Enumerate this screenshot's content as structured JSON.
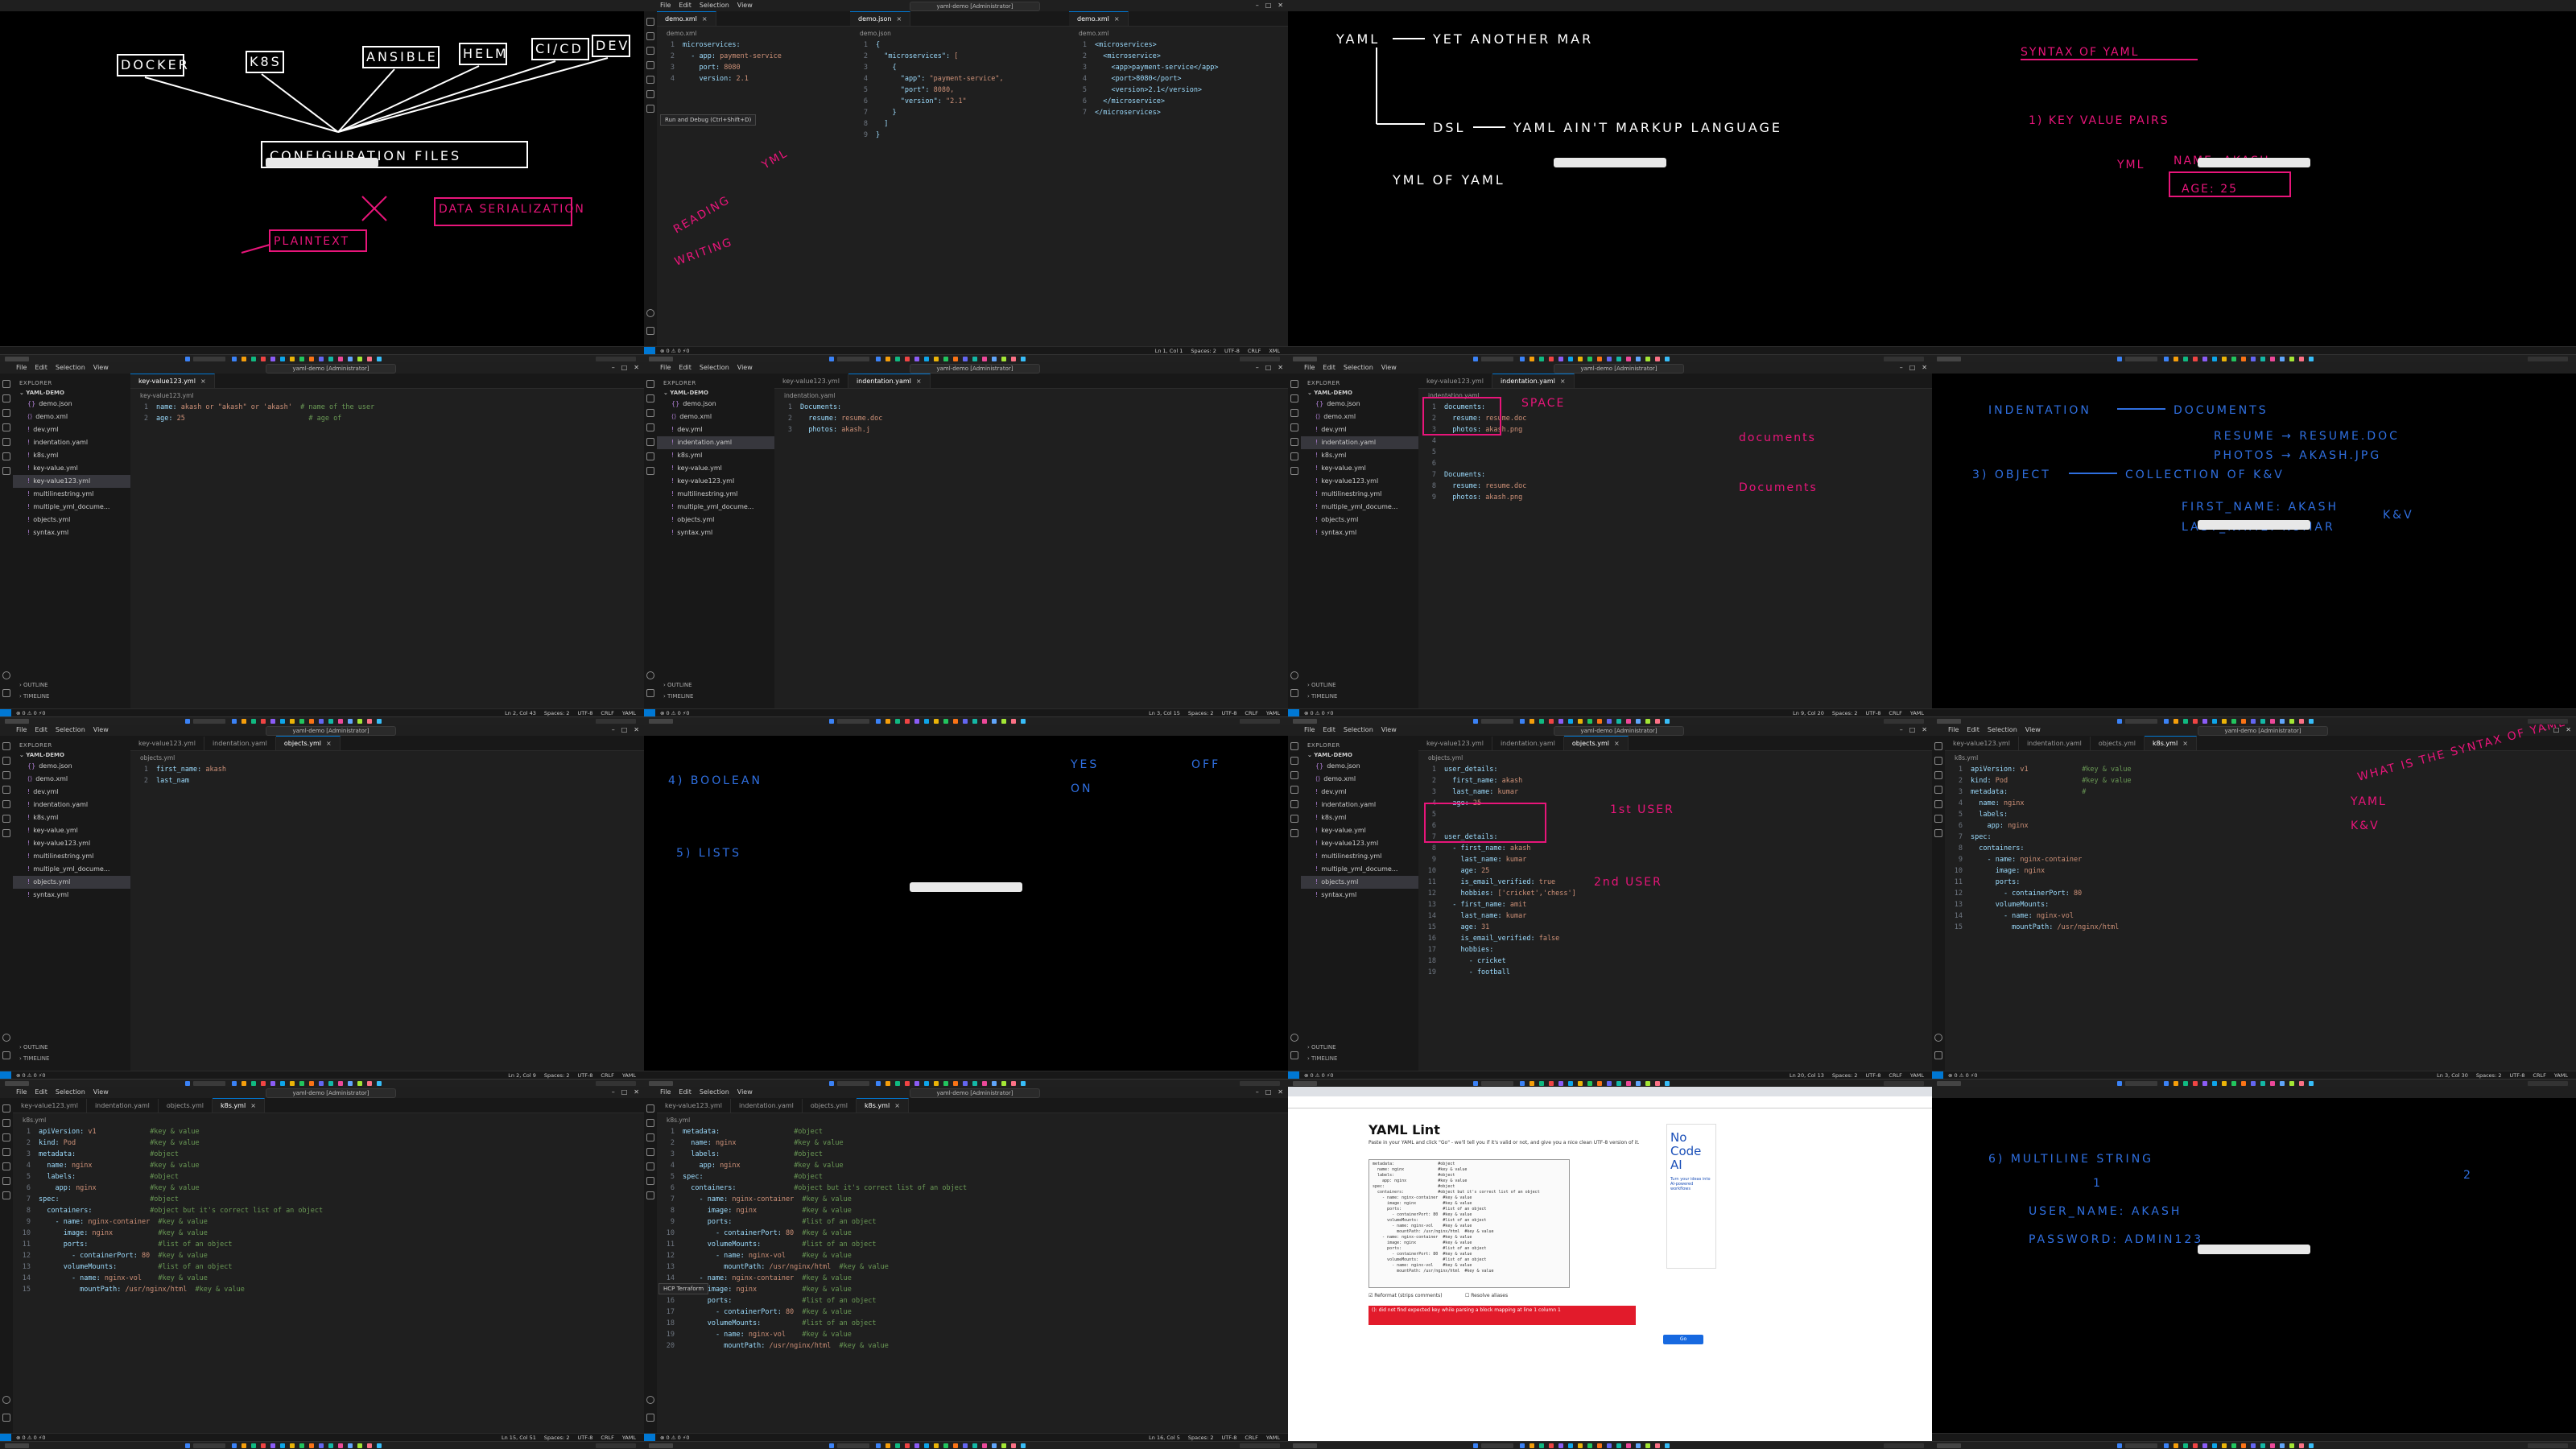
{
  "window": {
    "title": "yaml-demo [Administrator]",
    "menu": [
      "File",
      "Edit",
      "Selection",
      "View"
    ]
  },
  "explorer": {
    "header": "EXPLORER",
    "folder": "YAML-DEMO",
    "outline": "OUTLINE",
    "timeline": "TIMELINE"
  },
  "status": {
    "spaces": "Spaces: 2",
    "encoding": "UTF-8",
    "eol": "CRLF",
    "lang": "YAML"
  },
  "tiles": {
    "t1": {
      "words": [
        "DOCKER",
        "K8S",
        "ANSIBLE",
        "HELM",
        "CI/CD",
        "DEV"
      ],
      "center": "CONFIGURATION FILES",
      "p1": "PLAINTEXT",
      "p2": "DATA SERIALIZATION"
    },
    "t2": {
      "tabs": [
        "demo.xml",
        "demo.json",
        "demo.xml"
      ],
      "leftCode": [
        "microservices:",
        "  - app: payment-service",
        "    port: 8080",
        "    version: 2.1"
      ],
      "midCode": [
        "{",
        "  \"microservices\": [",
        "    {",
        "      \"app\": \"payment-service\",",
        "      \"port\": 8080,",
        "      \"version\": \"2.1\"",
        "    }",
        "  ]",
        "}"
      ],
      "rightCode": [
        "<microservices>",
        "  <microservice>",
        "    <app>payment-service</app>",
        "    <port>8080</port>",
        "    <version>2.1</version>",
        "  </microservice>",
        "</microservices>"
      ],
      "hover": "Run and Debug (Ctrl+Shift+D)",
      "ink1": "READING",
      "ink2": "WRITING",
      "ink3": "YML",
      "cursor": "Ln 1, Col 1",
      "lang": "XML"
    },
    "t3": {
      "l1a": "YAML",
      "l1b": "YET ANOTHER MAR",
      "l2a": "DSL",
      "l2b": "YAML AIN'T MARKUP LANGUAGE",
      "l3": "YML OF YAML"
    },
    "t4": {
      "title": "SYNTAX OF YAML",
      "item": "1) KEY VALUE PAIRS",
      "ex1": "NAME: AKASH",
      "ex2": "AGE: 25",
      "lbl": "YML"
    },
    "t5": {
      "tab": "key-value123.yml",
      "code": [
        "name: akash or \"akash\" or 'akash'  # name of the user",
        "age: 25                              # age of"
      ],
      "cursor": "Ln 2, Col 43"
    },
    "t6": {
      "tabs": [
        "key-value123.yml",
        "indentation.yaml"
      ],
      "code": [
        "Documents:",
        "  resume: resume.doc",
        "  photos: akash.j"
      ],
      "cursor": "Ln 3, Col 15"
    },
    "t7": {
      "tabs": [
        "key-value123.yml",
        "indentation.yaml"
      ],
      "code": [
        "documents:",
        "  resume: resume.doc",
        "  photos: akash.png",
        "",
        "",
        "",
        "Documents:",
        "  resume: resume.doc",
        "  photos: akash.png"
      ],
      "ink1": "SPACE",
      "ink2": "documents",
      "ink3": "Documents",
      "cursor": "Ln 9, Col 20"
    },
    "t8": {
      "l1a": "INDENTATION",
      "l1b": "DOCUMENTS",
      "l2": "RESUME → RESUME.DOC",
      "l3": "PHOTOS → AKASH.JPG",
      "l4a": "3) OBJECT",
      "l4b": "COLLECTION OF K&V",
      "l5": "FIRST_NAME: AKASH",
      "l6": "LAST_NAME: KUMAR",
      "l7": "K&V"
    },
    "t9": {
      "tabs": [
        "key-value123.yml",
        "indentation.yaml",
        "objects.yml"
      ],
      "code": [
        "first_name: akash",
        "last_nam"
      ],
      "cursor": "Ln 2, Col 9"
    },
    "t10": {
      "l1": "4) BOOLEAN",
      "l2": "5) LISTS",
      "l3": "YES",
      "l4": "ON",
      "l5": "OFF"
    },
    "t11": {
      "tabs": [
        "key-value123.yml",
        "indentation.yaml",
        "objects.yml"
      ],
      "code": [
        "user_details:",
        "  first_name: akash",
        "  last_name: kumar",
        "  age: 25",
        "",
        "",
        "user_details:",
        "  - first_name: akash",
        "    last_name: kumar",
        "    age: 25",
        "    is_email_verified: true",
        "    hobbies: ['cricket','chess']",
        "  - first_name: amit",
        "    last_name: kumar",
        "    age: 31",
        "    is_email_verified: false",
        "    hobbies:",
        "      - cricket",
        "      - football"
      ],
      "ink1": "1st USER",
      "ink2": "2nd USER",
      "cursor": "Ln 20, Col 13"
    },
    "t12": {
      "tabs": [
        "key-value123.yml",
        "indentation.yaml",
        "objects.yml",
        "k8s.yml"
      ],
      "code": [
        "apiVersion: v1             #key & value",
        "kind: Pod                  #key & value",
        "metadata:                  #",
        "  name: nginx",
        "  labels:",
        "    app: nginx",
        "spec:",
        "  containers:",
        "    - name: nginx-container",
        "      image: nginx",
        "      ports:",
        "        - containerPort: 80",
        "      volumeMounts:",
        "        - name: nginx-vol",
        "          mountPath: /usr/nginx/html"
      ],
      "ink1": "WHAT IS THE SYNTAX OF YAML",
      "ink2": "YAML",
      "ink3": "K&V",
      "cursor": "Ln 3, Col 30"
    },
    "t13": {
      "tabs": [
        "key-value123.yml",
        "indentation.yaml",
        "objects.yml",
        "k8s.yml"
      ],
      "code": [
        "apiVersion: v1             #key & value",
        "kind: Pod                  #key & value",
        "metadata:                  #object",
        "  name: nginx              #key & value",
        "  labels:                  #object",
        "    app: nginx             #key & value",
        "spec:                      #object",
        "  containers:              #object but it's correct list of an object",
        "    - name: nginx-container  #key & value",
        "      image: nginx           #key & value",
        "      ports:                 #list of an object",
        "        - containerPort: 80  #key & value",
        "      volumeMounts:          #list of an object",
        "        - name: nginx-vol    #key & value",
        "          mountPath: /usr/nginx/html  #key & value"
      ],
      "cursor": "Ln 15, Col 51"
    },
    "t14": {
      "tabs": [
        "key-value123.yml",
        "indentation.yaml",
        "objects.yml",
        "k8s.yml"
      ],
      "code": [
        "metadata:                  #object",
        "  name: nginx              #key & value",
        "  labels:                  #object",
        "    app: nginx             #key & value",
        "spec:                      #object",
        "  containers:              #object but it's correct list of an object",
        "    - name: nginx-container  #key & value",
        "      image: nginx           #key & value",
        "      ports:                 #list of an object",
        "        - containerPort: 80  #key & value",
        "      volumeMounts:          #list of an object",
        "        - name: nginx-vol    #key & value",
        "          mountPath: /usr/nginx/html  #key & value",
        "    - name: nginx-container  #key & value",
        "      image: nginx           #key & value",
        "      ports:                 #list of an object",
        "        - containerPort: 80  #key & value",
        "      volumeMounts:          #list of an object",
        "        - name: nginx-vol    #key & value",
        "          mountPath: /usr/nginx/html  #key & value"
      ],
      "hover": "HCP Terraform",
      "cursor": "Ln 16, Col 5"
    },
    "t15": {
      "title": "YAML Lint",
      "intro": "Paste in your YAML and click \"Go\" - we'll tell you if it's valid or not, and give you a nice clean UTF-8 version of it.",
      "err": "(): did not find expected key while parsing a block mapping at line 1 column 1",
      "adBig": "No Code AI",
      "adSmall": "Turn your ideas into AI-powered workflows",
      "go": "Go",
      "opt1": "Reformat (strips comments)",
      "opt2": "Resolve aliases"
    },
    "t16": {
      "l1": "6) MULTILINE STRING",
      "l2": "USER_NAME: AKASH",
      "l3": "PASSWORD: ADMIN123",
      "n1": "1",
      "n2": "2"
    }
  },
  "colors": {
    "ink_pink": "#e8157a",
    "ink_blue": "#2f6fe0",
    "accent": "#0078d4",
    "editor_bg": "#1f1f1f",
    "sidebar_bg": "#181818"
  },
  "files": [
    "demo.json",
    "demo.xml",
    "dev.yml",
    "indentation.yaml",
    "k8s.yml",
    "key-value.yml",
    "key-value123.yml",
    "multilinestring.yml",
    "multiple_yml_docume...",
    "objects.yml",
    "syntax.yml"
  ]
}
